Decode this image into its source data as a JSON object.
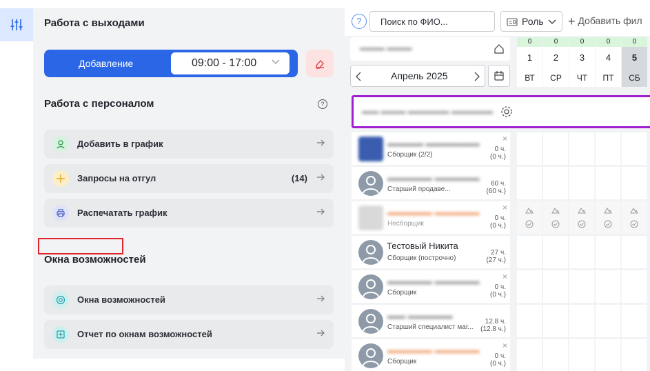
{
  "left_panel": {
    "shifts_title": "Работа с выходами",
    "add_label": "Добавление",
    "time_value": "09:00 - 17:00",
    "staff_title": "Работа с персоналом",
    "staff_items": [
      {
        "label": "Добавить в график",
        "count": ""
      },
      {
        "label": "Запросы на отгул",
        "count": "(14)"
      },
      {
        "label": "Распечатать график",
        "count": ""
      }
    ],
    "windows_title": "Окна возможностей",
    "windows_items": [
      {
        "label": "Окна возможностей"
      },
      {
        "label": "Отчет по окнам возможностей"
      }
    ]
  },
  "toolbar": {
    "help": "?",
    "search_placeholder": "Поиск по ФИО...",
    "role_label": "Роль",
    "add_filter": "Добавить фил"
  },
  "calendar": {
    "month": "Апрель 2025",
    "days": [
      {
        "count": "0",
        "num": "1",
        "wd": "ВТ"
      },
      {
        "count": "0",
        "num": "2",
        "wd": "СР"
      },
      {
        "count": "0",
        "num": "3",
        "wd": "ЧТ"
      },
      {
        "count": "0",
        "num": "4",
        "wd": "ПТ"
      },
      {
        "count": "0",
        "num": "5",
        "wd": "СБ"
      }
    ]
  },
  "employees": [
    {
      "name": "",
      "role": "Сборщик (2/2)",
      "hours": "0 ч.",
      "hours2": "(0 ч.)"
    },
    {
      "name": "",
      "role": "Старший продаве...",
      "hours": "60 ч.",
      "hours2": "(60 ч.)"
    },
    {
      "name": "",
      "role": "Несборщик",
      "hours": "0 ч.",
      "hours2": "(0 ч.)"
    },
    {
      "name": "Тестовый Никита",
      "role": "Сборщик (построчно)",
      "hours": "27 ч.",
      "hours2": "(27 ч.)"
    },
    {
      "name": "",
      "role": "Сборщик",
      "hours": "0 ч.",
      "hours2": "(0 ч.)"
    },
    {
      "name": "",
      "role": "Старший специалист маг...",
      "hours": "12.8 ч.",
      "hours2": "(12.8 ч.)"
    },
    {
      "name": "",
      "role": "Сборщик",
      "hours": "0 ч.",
      "hours2": "(0 ч.)"
    }
  ]
}
